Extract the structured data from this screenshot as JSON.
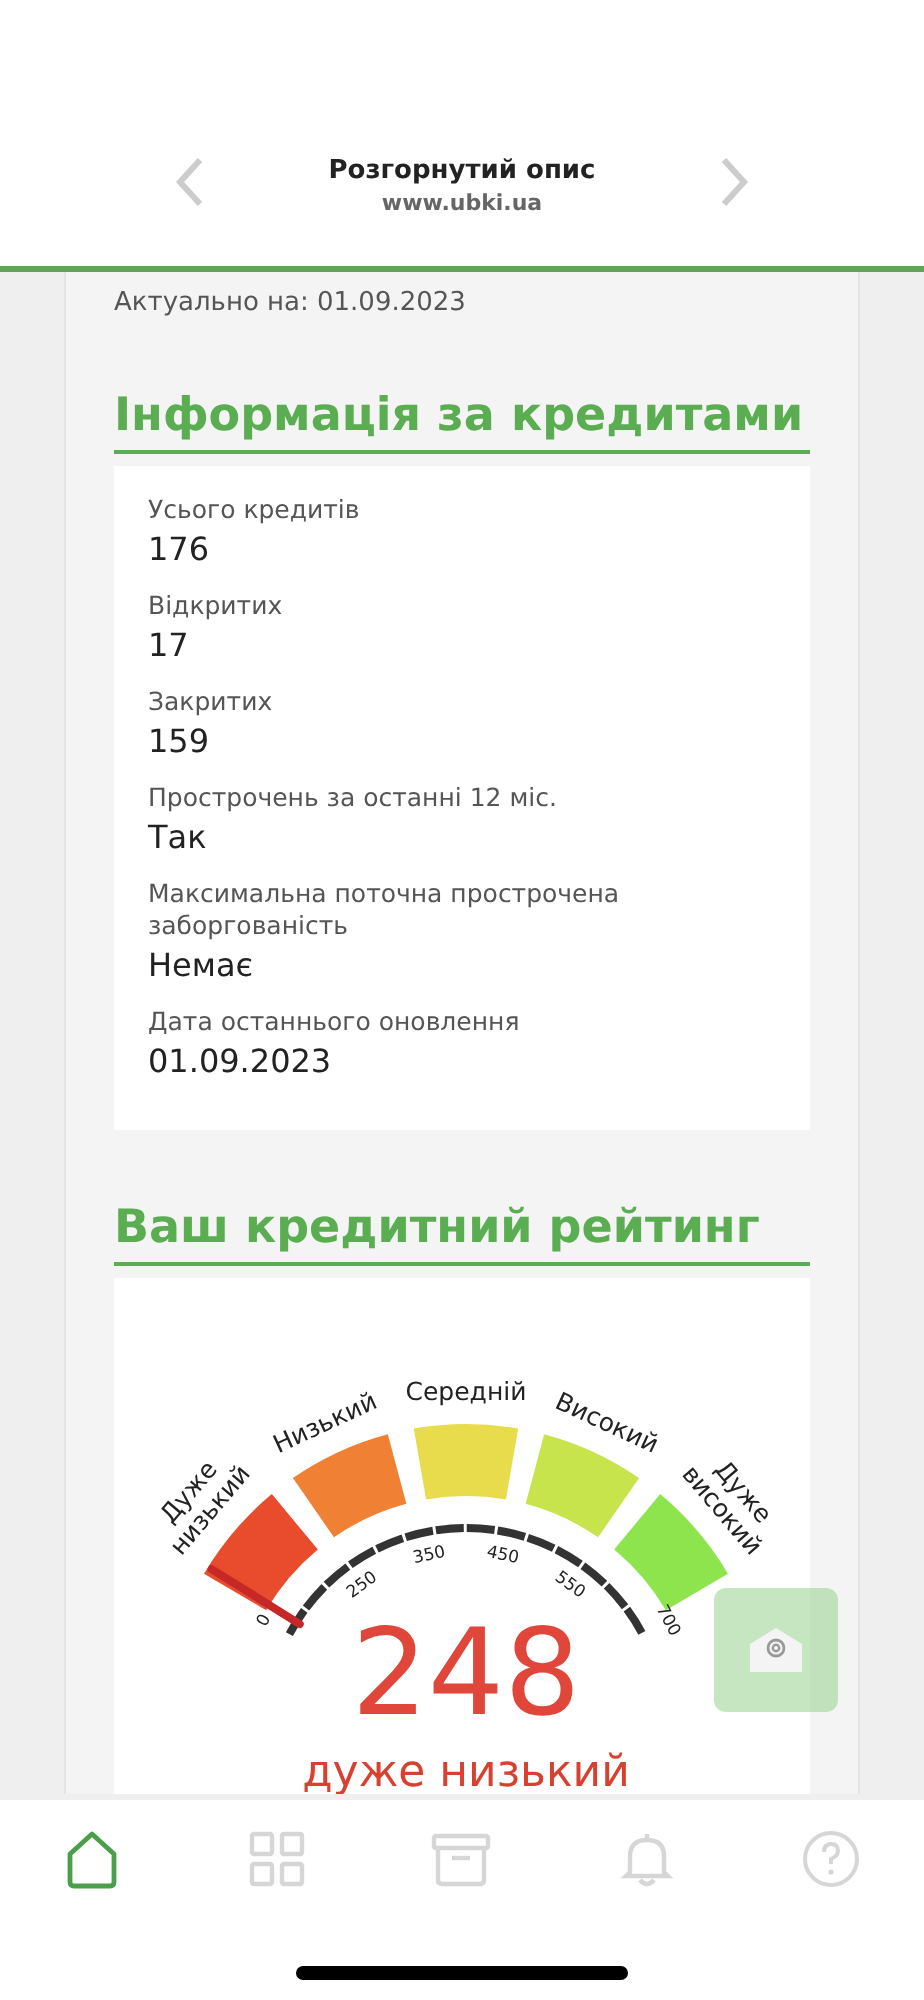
{
  "header": {
    "title": "Розгорнутий опис",
    "url": "www.ubki.ua"
  },
  "updated": "Актуально на: 01.09.2023",
  "credit_info": {
    "heading": "Інформація за кредитами",
    "fields": [
      {
        "label": "Усього кредитів",
        "value": "176"
      },
      {
        "label": "Відкритих",
        "value": "17"
      },
      {
        "label": "Закритих",
        "value": "159"
      },
      {
        "label": "Прострочень за останні 12 міс.",
        "value": "Так"
      },
      {
        "label": "Максимальна поточна прострочена заборгованість",
        "value": "Немає"
      },
      {
        "label": "Дата останнього оновлення",
        "value": "01.09.2023"
      }
    ]
  },
  "rating": {
    "heading": "Ваш кредитний рейтинг",
    "segments": [
      {
        "label": "Дуже низький",
        "color": "#e84c2c"
      },
      {
        "label": "Низький",
        "color": "#ef8034"
      },
      {
        "label": "Середній",
        "color": "#e8dc4c"
      },
      {
        "label": "Високий",
        "color": "#c8e44c"
      },
      {
        "label": "Дуже високий",
        "color": "#8ee44c"
      }
    ],
    "ticks": [
      "0",
      "250",
      "350",
      "450",
      "550",
      "700"
    ],
    "score": "248",
    "grade": "дуже низький"
  },
  "nav": [
    {
      "kind": "home",
      "selected": true
    },
    {
      "kind": "grid",
      "selected": false
    },
    {
      "kind": "archive",
      "selected": false
    },
    {
      "kind": "bell",
      "selected": false
    },
    {
      "kind": "help",
      "selected": false
    }
  ]
}
